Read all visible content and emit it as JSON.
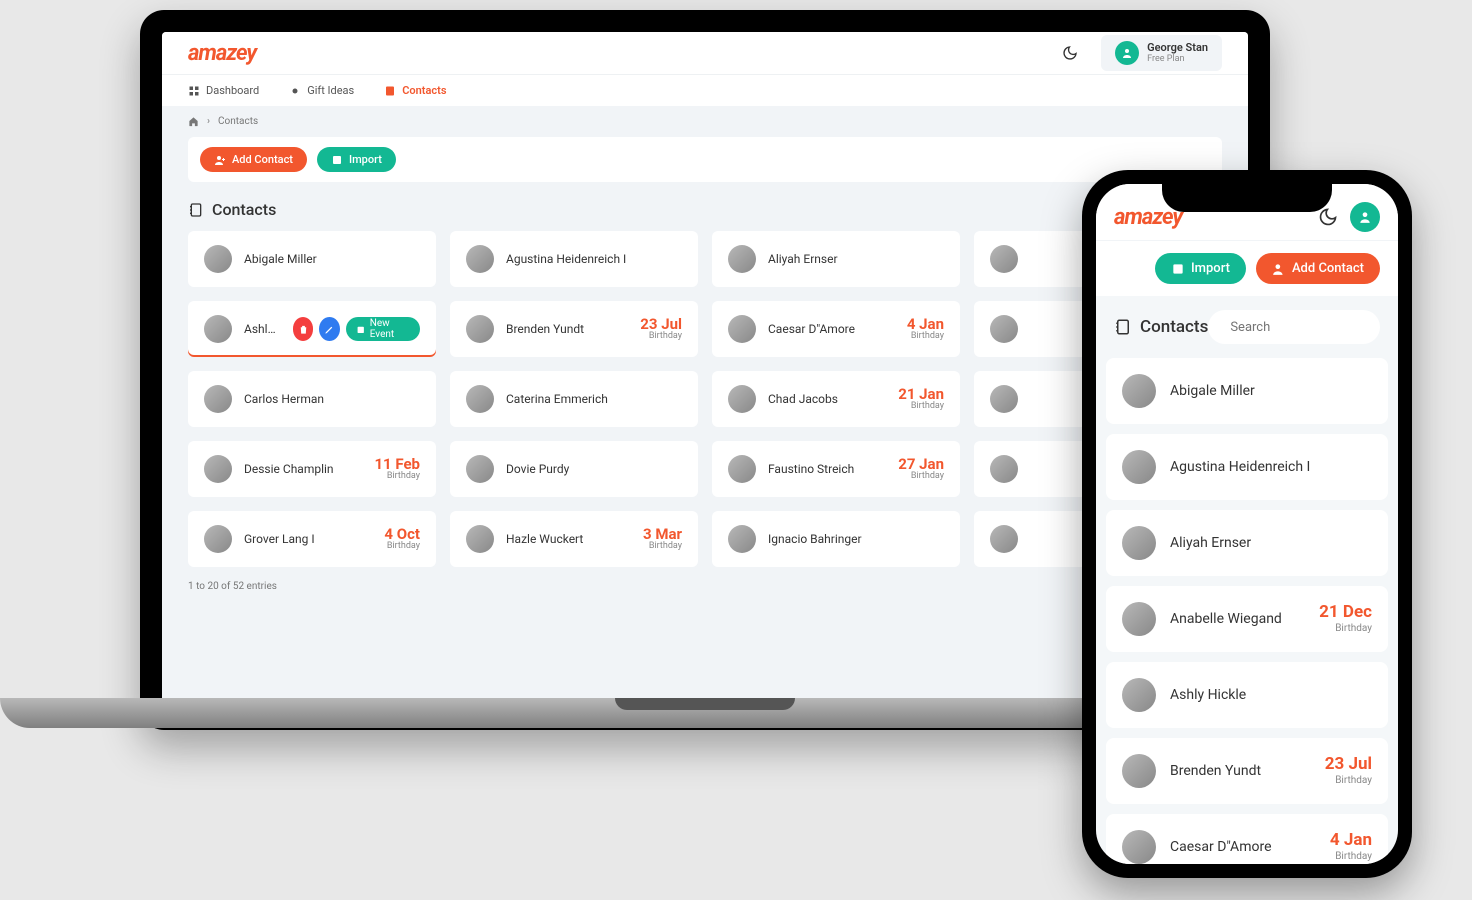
{
  "brand": "amazey",
  "user": {
    "name": "George Stan",
    "plan": "Free Plan"
  },
  "nav": {
    "dashboard": "Dashboard",
    "gift_ideas": "Gift Ideas",
    "contacts": "Contacts"
  },
  "breadcrumb": {
    "current": "Contacts"
  },
  "buttons": {
    "add_contact": "Add Contact",
    "import": "Import",
    "new_event": "New Event"
  },
  "section_title": "Contacts",
  "pagination": "1 to 20 of 52 entries",
  "search_placeholder": "Search",
  "contacts_desktop": [
    {
      "name": "Abigale Miller"
    },
    {
      "name": "Agustina Heidenreich I"
    },
    {
      "name": "Aliyah Ernser"
    },
    {
      "name": ""
    },
    {
      "name": "Ashly H",
      "hover": true
    },
    {
      "name": "Brenden Yundt",
      "date": "23 Jul",
      "event": "Birthday"
    },
    {
      "name": "Caesar D\"Amore",
      "date": "4 Jan",
      "event": "Birthday"
    },
    {
      "name": ""
    },
    {
      "name": "Carlos Herman"
    },
    {
      "name": "Caterina Emmerich"
    },
    {
      "name": "Chad Jacobs",
      "date": "21 Jan",
      "event": "Birthday"
    },
    {
      "name": ""
    },
    {
      "name": "Dessie Champlin",
      "date": "11 Feb",
      "event": "Birthday"
    },
    {
      "name": "Dovie Purdy"
    },
    {
      "name": "Faustino Streich",
      "date": "27 Jan",
      "event": "Birthday"
    },
    {
      "name": ""
    },
    {
      "name": "Grover Lang I",
      "date": "4 Oct",
      "event": "Birthday"
    },
    {
      "name": "Hazle Wuckert",
      "date": "3 Mar",
      "event": "Birthday"
    },
    {
      "name": "Ignacio Bahringer"
    },
    {
      "name": ""
    }
  ],
  "contacts_mobile": [
    {
      "name": "Abigale Miller"
    },
    {
      "name": "Agustina Heidenreich I"
    },
    {
      "name": "Aliyah Ernser"
    },
    {
      "name": "Anabelle Wiegand",
      "date": "21 Dec",
      "event": "Birthday"
    },
    {
      "name": "Ashly Hickle"
    },
    {
      "name": "Brenden Yundt",
      "date": "23 Jul",
      "event": "Birthday"
    },
    {
      "name": "Caesar D\"Amore",
      "date": "4 Jan",
      "event": "Birthday"
    }
  ]
}
